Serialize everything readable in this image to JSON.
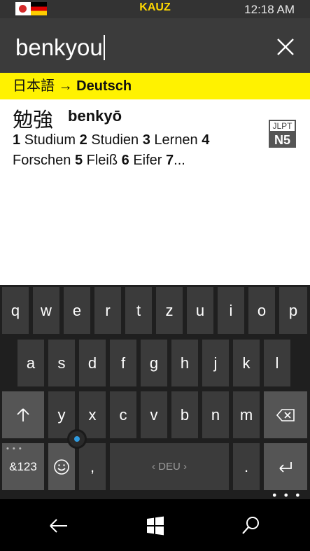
{
  "status_bar": {
    "app_title": "KAUZ",
    "time": "12:18 AM",
    "flags": [
      "japan-flag-icon",
      "germany-flag-icon"
    ]
  },
  "search": {
    "value": "benkyou",
    "clear_icon": "close-icon"
  },
  "language_bar": {
    "source": "日本語",
    "arrow": "→",
    "target": "Deutsch"
  },
  "result": {
    "kanji": "勉強",
    "reading": "benkyō",
    "meanings": [
      {
        "n": "1",
        "text": "Studium"
      },
      {
        "n": "2",
        "text": "Studien"
      },
      {
        "n": "3",
        "text": "Lernen"
      },
      {
        "n": "4",
        "text": "Forschen"
      },
      {
        "n": "5",
        "text": "Fleiß"
      },
      {
        "n": "6",
        "text": "Eifer"
      },
      {
        "n": "7",
        "text": "..."
      }
    ],
    "jlpt": {
      "label": "JLPT",
      "level": "N5"
    }
  },
  "keyboard": {
    "row1": [
      "q",
      "w",
      "e",
      "r",
      "t",
      "z",
      "u",
      "i",
      "o",
      "p"
    ],
    "row2": [
      "a",
      "s",
      "d",
      "f",
      "g",
      "h",
      "j",
      "k",
      "l"
    ],
    "row3": [
      "y",
      "x",
      "c",
      "v",
      "b",
      "n",
      "m"
    ],
    "shift_icon": "shift-arrow-icon",
    "backspace_icon": "backspace-icon",
    "numbers_label": "&123",
    "emoji_icon": "emoji-icon",
    "comma": ",",
    "space_label": "‹ DEU ›",
    "period": ".",
    "enter_icon": "enter-icon",
    "cursor_icon": "cursor-control-icon",
    "more_icon": "more-icon"
  },
  "nav": {
    "back_icon": "back-arrow-icon",
    "home_icon": "windows-icon",
    "search_icon": "search-icon"
  },
  "colors": {
    "accent_yellow": "#fff200",
    "title_yellow": "#ffd800",
    "key_bg": "#3b3b3b",
    "key_func_bg": "#555555",
    "cursor_blue": "#2f9be0"
  }
}
